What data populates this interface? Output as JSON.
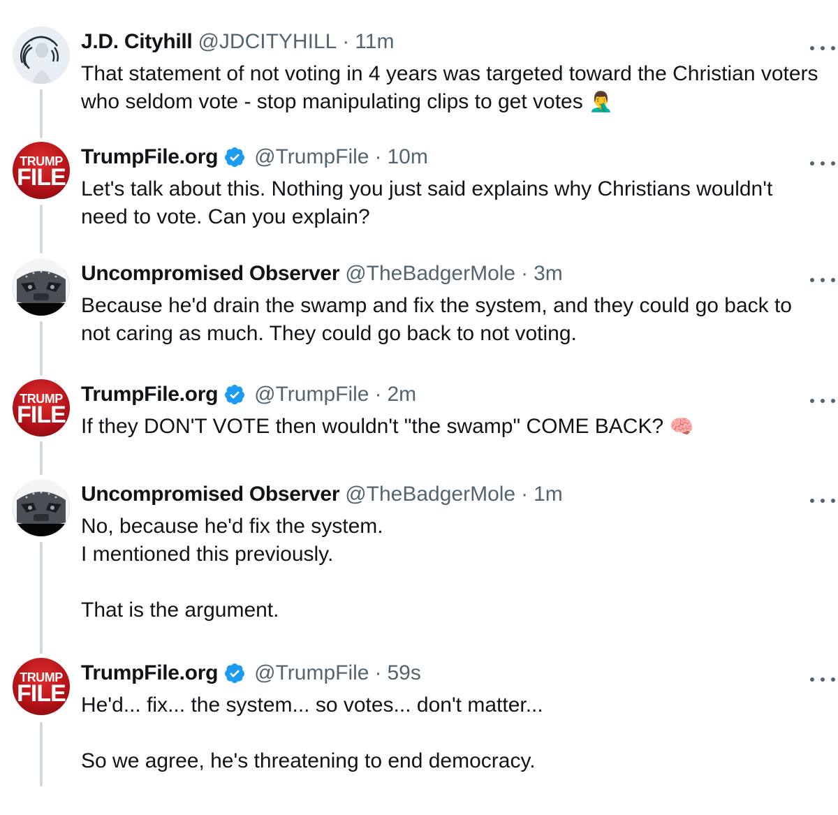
{
  "tweets": [
    {
      "name": "J.D. Cityhill",
      "handle": "@JDCITYHILL",
      "sep": "·",
      "time": "11m",
      "verified": false,
      "avatar": "jd-cityhill-avatar",
      "text": "That statement of not voting in 4 years was targeted toward the Christian voters who seldom vote - stop manipulating clips to get votes",
      "emoji": "🤦‍♂️"
    },
    {
      "name": "TrumpFile.org",
      "handle": "@TrumpFile",
      "sep": "·",
      "time": "10m",
      "verified": true,
      "avatar": "trumpfile-avatar",
      "avatar_text_top": "TRUMP",
      "avatar_text_bottom": "FILE",
      "text": "Let's talk about this. Nothing you just said explains why Christians wouldn't need to vote. Can you explain?"
    },
    {
      "name": "Uncompromised Observer",
      "handle": "@TheBadgerMole",
      "sep": "·",
      "time": "3m",
      "verified": false,
      "avatar": "badger-avatar",
      "text": "Because he'd drain the swamp and fix the system, and they could go back to not caring as much. They could go back to not voting."
    },
    {
      "name": "TrumpFile.org",
      "handle": "@TrumpFile",
      "sep": "·",
      "time": "2m",
      "verified": true,
      "avatar": "trumpfile-avatar",
      "avatar_text_top": "TRUMP",
      "avatar_text_bottom": "FILE",
      "text": "If they DON'T VOTE then wouldn't \"the swamp\" COME BACK?",
      "emoji": "🧠"
    },
    {
      "name": "Uncompromised Observer",
      "handle": "@TheBadgerMole",
      "sep": "·",
      "time": "1m",
      "verified": false,
      "avatar": "badger-avatar",
      "text": "No, because he'd fix the system.\nI mentioned this previously.\n\nThat is the argument."
    },
    {
      "name": "TrumpFile.org",
      "handle": "@TrumpFile",
      "sep": "·",
      "time": "59s",
      "verified": true,
      "avatar": "trumpfile-avatar",
      "avatar_text_top": "TRUMP",
      "avatar_text_bottom": "FILE",
      "text": "He'd... fix... the system... so votes... don't matter...\n\nSo we agree, he's threatening to end democracy."
    }
  ],
  "colors": {
    "text": "#0f1419",
    "secondary": "#536471",
    "verified": "#1d9bf0",
    "thread_line": "#cfd9de",
    "trump_red": "#b01218"
  }
}
